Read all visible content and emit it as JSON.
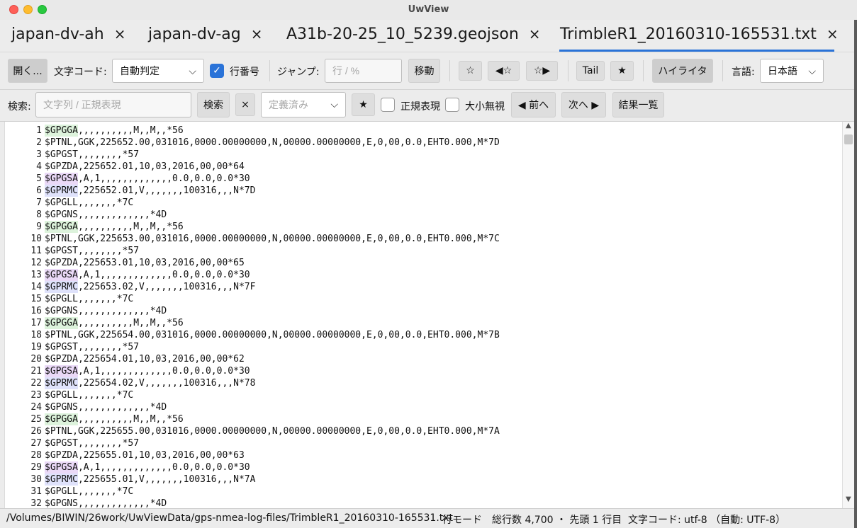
{
  "window": {
    "title": "UwView"
  },
  "tabs": [
    {
      "label": "japan-dv-ah",
      "close": "×"
    },
    {
      "label": "japan-dv-ag",
      "close": "×"
    },
    {
      "label": "A31b-20-25_10_5239.geojson",
      "close": "×"
    },
    {
      "label": "TrimbleR1_20160310-165531.txt",
      "close": "×",
      "active": true
    }
  ],
  "toolbar": {
    "open_label": "開く...",
    "encoding_label": "文字コード:",
    "encoding_value": "自動判定",
    "line_numbers_label": "行番号",
    "line_numbers_checked": true,
    "jump_label": "ジャンプ:",
    "jump_placeholder": "行 / %",
    "move_label": "移動",
    "bookmark_toggle": "☆",
    "bookmark_prev": "◀☆",
    "bookmark_next": "☆▶",
    "tail_label": "Tail",
    "tail_star": "★",
    "highlighter_label": "ハイライタ",
    "language_label": "言語:",
    "language_value": "日本語"
  },
  "search": {
    "label": "検索:",
    "placeholder": "文字列 / 正規表現",
    "search_button": "検索",
    "clear_button": "×",
    "preset_placeholder": "定義済み",
    "star_button": "★",
    "regex_label": "正規表現",
    "ignore_case_label": "大小無視",
    "prev_button": "◀ 前へ",
    "next_button": "次へ ▶",
    "results_button": "結果一覧"
  },
  "editor": {
    "lines": [
      {
        "n": "1",
        "tag": "$GPGGA",
        "rest": ",,,,,,,,,,M,,M,,*56",
        "hl": "gga"
      },
      {
        "n": "2",
        "tag": "$PTNL",
        "rest": ",GGK,225652.00,031016,0000.00000000,N,00000.00000000,E,0,00,0.0,EHT0.000,M*7D",
        "hl": ""
      },
      {
        "n": "3",
        "tag": "$GPGST",
        "rest": ",,,,,,,,*57",
        "hl": ""
      },
      {
        "n": "4",
        "tag": "$GPZDA",
        "rest": ",225652.01,10,03,2016,00,00*64",
        "hl": ""
      },
      {
        "n": "5",
        "tag": "$GPGSA",
        "rest": ",A,1,,,,,,,,,,,,,0.0,0.0,0.0*30",
        "hl": "gsa"
      },
      {
        "n": "6",
        "tag": "$GPRMC",
        "rest": ",225652.01,V,,,,,,,100316,,,N*7D",
        "hl": "rmc"
      },
      {
        "n": "7",
        "tag": "$GPGLL",
        "rest": ",,,,,,,*7C",
        "hl": ""
      },
      {
        "n": "8",
        "tag": "$GPGNS",
        "rest": ",,,,,,,,,,,,,*4D",
        "hl": ""
      },
      {
        "n": "9",
        "tag": "$GPGGA",
        "rest": ",,,,,,,,,,M,,M,,*56",
        "hl": "gga"
      },
      {
        "n": "10",
        "tag": "$PTNL",
        "rest": ",GGK,225653.00,031016,0000.00000000,N,00000.00000000,E,0,00,0.0,EHT0.000,M*7C",
        "hl": ""
      },
      {
        "n": "11",
        "tag": "$GPGST",
        "rest": ",,,,,,,,*57",
        "hl": ""
      },
      {
        "n": "12",
        "tag": "$GPZDA",
        "rest": ",225653.01,10,03,2016,00,00*65",
        "hl": ""
      },
      {
        "n": "13",
        "tag": "$GPGSA",
        "rest": ",A,1,,,,,,,,,,,,,0.0,0.0,0.0*30",
        "hl": "gsa"
      },
      {
        "n": "14",
        "tag": "$GPRMC",
        "rest": ",225653.02,V,,,,,,,100316,,,N*7F",
        "hl": "rmc"
      },
      {
        "n": "15",
        "tag": "$GPGLL",
        "rest": ",,,,,,,*7C",
        "hl": ""
      },
      {
        "n": "16",
        "tag": "$GPGNS",
        "rest": ",,,,,,,,,,,,,*4D",
        "hl": ""
      },
      {
        "n": "17",
        "tag": "$GPGGA",
        "rest": ",,,,,,,,,,M,,M,,*56",
        "hl": "gga"
      },
      {
        "n": "18",
        "tag": "$PTNL",
        "rest": ",GGK,225654.00,031016,0000.00000000,N,00000.00000000,E,0,00,0.0,EHT0.000,M*7B",
        "hl": ""
      },
      {
        "n": "19",
        "tag": "$GPGST",
        "rest": ",,,,,,,,*57",
        "hl": ""
      },
      {
        "n": "20",
        "tag": "$GPZDA",
        "rest": ",225654.01,10,03,2016,00,00*62",
        "hl": ""
      },
      {
        "n": "21",
        "tag": "$GPGSA",
        "rest": ",A,1,,,,,,,,,,,,,0.0,0.0,0.0*30",
        "hl": "gsa"
      },
      {
        "n": "22",
        "tag": "$GPRMC",
        "rest": ",225654.02,V,,,,,,,100316,,,N*78",
        "hl": "rmc"
      },
      {
        "n": "23",
        "tag": "$GPGLL",
        "rest": ",,,,,,,*7C",
        "hl": ""
      },
      {
        "n": "24",
        "tag": "$GPGNS",
        "rest": ",,,,,,,,,,,,,*4D",
        "hl": ""
      },
      {
        "n": "25",
        "tag": "$GPGGA",
        "rest": ",,,,,,,,,,M,,M,,*56",
        "hl": "gga"
      },
      {
        "n": "26",
        "tag": "$PTNL",
        "rest": ",GGK,225655.00,031016,0000.00000000,N,00000.00000000,E,0,00,0.0,EHT0.000,M*7A",
        "hl": ""
      },
      {
        "n": "27",
        "tag": "$GPGST",
        "rest": ",,,,,,,,*57",
        "hl": ""
      },
      {
        "n": "28",
        "tag": "$GPZDA",
        "rest": ",225655.01,10,03,2016,00,00*63",
        "hl": ""
      },
      {
        "n": "29",
        "tag": "$GPGSA",
        "rest": ",A,1,,,,,,,,,,,,,0.0,0.0,0.0*30",
        "hl": "gsa"
      },
      {
        "n": "30",
        "tag": "$GPRMC",
        "rest": ",225655.01,V,,,,,,,100316,,,N*7A",
        "hl": "rmc"
      },
      {
        "n": "31",
        "tag": "$GPGLL",
        "rest": ",,,,,,,*7C",
        "hl": ""
      },
      {
        "n": "32",
        "tag": "$GPGNS",
        "rest": ",,,,,,,,,,,,,*4D",
        "hl": ""
      }
    ]
  },
  "scrollbar": {
    "up": "▲",
    "down": "▼"
  },
  "status": {
    "path": "/Volumes/BIWIN/26work/UwViewData/gps-nmea-log-files/TrimbleR1_20160310-165531.txt",
    "mode": "行モード",
    "total": "総行数 4,700 ・ 先頭 1 行目",
    "encoding": "文字コード: utf-8 （自動: UTF-8）"
  },
  "colors": {
    "accent": "#2a73d8",
    "gga_highlight": "#ddf3dc",
    "gsa_highlight": "#ead9f7",
    "rmc_highlight": "#dfe2fb"
  }
}
